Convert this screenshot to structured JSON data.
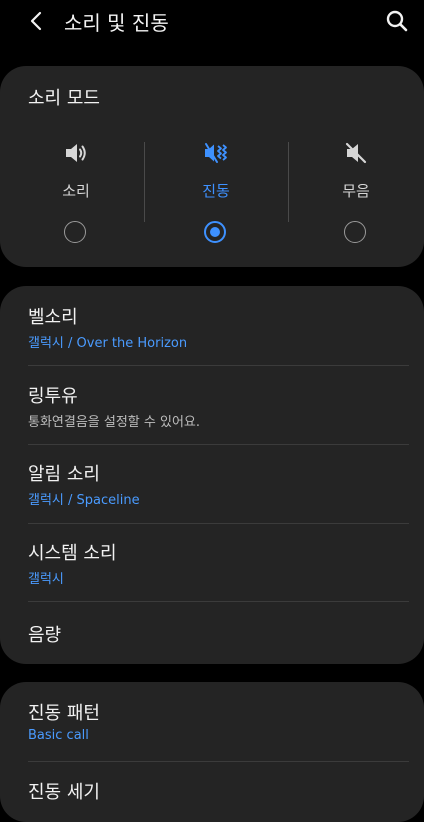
{
  "header": {
    "title": "소리 및 진동",
    "back_icon": "chevron-left-icon",
    "search_icon": "search-icon"
  },
  "sound_mode": {
    "title": "소리 모드",
    "options": [
      {
        "label": "소리",
        "icon": "speaker-icon",
        "selected": false
      },
      {
        "label": "진동",
        "icon": "vibrate-icon",
        "selected": true
      },
      {
        "label": "무음",
        "icon": "mute-icon",
        "selected": false
      }
    ]
  },
  "settings": [
    {
      "title": "벨소리",
      "subtitle": "갤럭시 / Over the Horizon"
    },
    {
      "title": "링투유",
      "subtitle": "통화연결음을 설정할 수 있어요."
    },
    {
      "title": "알림 소리",
      "subtitle": "갤럭시 / Spaceline"
    },
    {
      "title": "시스템 소리",
      "subtitle": "갤럭시"
    },
    {
      "title": "음량"
    }
  ],
  "settings2": [
    {
      "title": "진동 패턴",
      "subtitle": "Basic call"
    },
    {
      "title": "진동 세기"
    }
  ],
  "colors": {
    "background": "#000000",
    "card": "#242424",
    "accent": "#3e91ff",
    "subtitle_accent": "#4a9bff"
  }
}
